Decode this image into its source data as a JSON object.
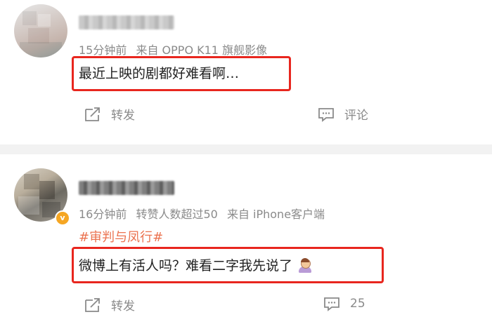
{
  "posts": [
    {
      "meta_time": "15分钟前",
      "meta_source": "来自 OPPO K11 旗舰影像",
      "content": "最近上映的剧都好难看啊…",
      "repost_label": "转发",
      "comment_label": "评论"
    },
    {
      "meta_time": "16分钟前",
      "meta_reposts": "转赞人数超过50",
      "meta_source": "来自 iPhone客户端",
      "topic": "#审判与凤行#",
      "content": "微博上有活人吗？难看二字我先说了",
      "emoji": "person-gesturing-no-icon",
      "repost_label": "转发",
      "comment_count": "25"
    }
  ],
  "colors": {
    "highlight": "#e8261e",
    "topic": "#eb7350",
    "meta": "#8a8a8a",
    "verified_badge": "#f5a623",
    "divider": "#f2f2f2"
  }
}
